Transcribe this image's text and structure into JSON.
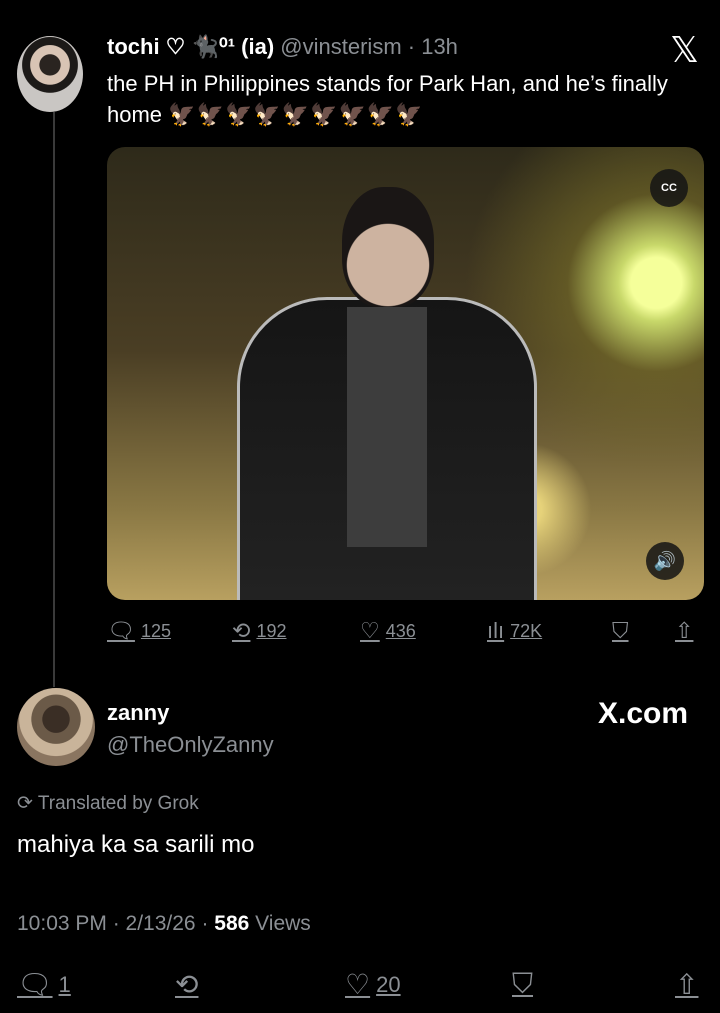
{
  "tweet": {
    "display_name": "tochi ♡",
    "name_suffix": "🐈‍⬛⁰¹ (ia)",
    "handle": "@vinsterism",
    "time": "· 13h",
    "text": "the PH in Philippines stands for Park Han, and he’s finally home",
    "emojis": "🦅🦅🦅🦅🦅🦅🦅🦅🦅",
    "media_cc": "CC",
    "media_sound": "🔊",
    "stats": {
      "replies": "125",
      "reposts": "192",
      "likes": "436",
      "views": "72K"
    }
  },
  "reply": {
    "display_name": "zanny",
    "handle": "@TheOnlyZanny",
    "source_label": "X.com",
    "translated_label": "⟳ Translated by Grok",
    "text": "mahiya ka sa sarili mo",
    "timestamp": "10:03 PM · 2/13/26 · ",
    "views_count": "586",
    "views_label": " Views",
    "stats": {
      "replies": "1",
      "likes": "20"
    }
  },
  "icons": {
    "x_logo": "x-logo-icon",
    "reply": "comment-icon",
    "repost": "repost-icon",
    "like": "heart-icon",
    "views": "views-bars-icon",
    "bookmark": "bookmark-icon",
    "share": "share-icon"
  },
  "colors": {
    "background": "#000000",
    "text": "#ffffff",
    "muted": "#8b8f94"
  }
}
